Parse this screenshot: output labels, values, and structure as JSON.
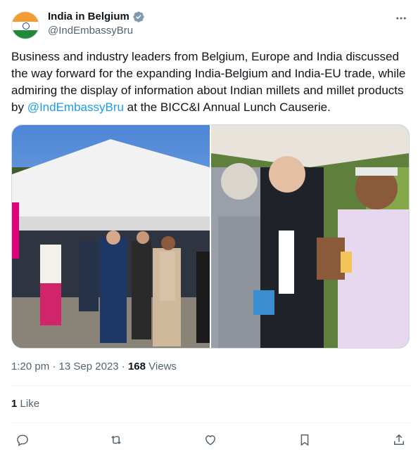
{
  "account": {
    "display_name": "India in Belgium",
    "handle": "@IndEmbassyBru"
  },
  "tweet": {
    "text_before_mention": "Business and industry leaders from Belgium, Europe and India discussed the way forward for the expanding India-Belgium and India-EU trade, while admiring the display of information about Indian millets and millet products by ",
    "mention": "@IndEmbassyBru",
    "text_after_mention": " at the BICC&I Annual Lunch Causerie."
  },
  "meta": {
    "time": "1:20 pm",
    "separator": " · ",
    "date": "13 Sep 2023",
    "views_count": "168",
    "views_label": "Views"
  },
  "engagement": {
    "likes_count": "1",
    "likes_label": "Like"
  },
  "icons": {
    "verified": "verified-badge-icon",
    "more": "more-horizontal-icon",
    "reply": "reply-icon",
    "retweet": "retweet-icon",
    "like": "heart-icon",
    "bookmark": "bookmark-icon",
    "share": "share-icon"
  },
  "colors": {
    "accent": "#1d9bf0",
    "secondary_text": "#536471",
    "primary_text": "#0f1419",
    "verified": "#829aab"
  }
}
